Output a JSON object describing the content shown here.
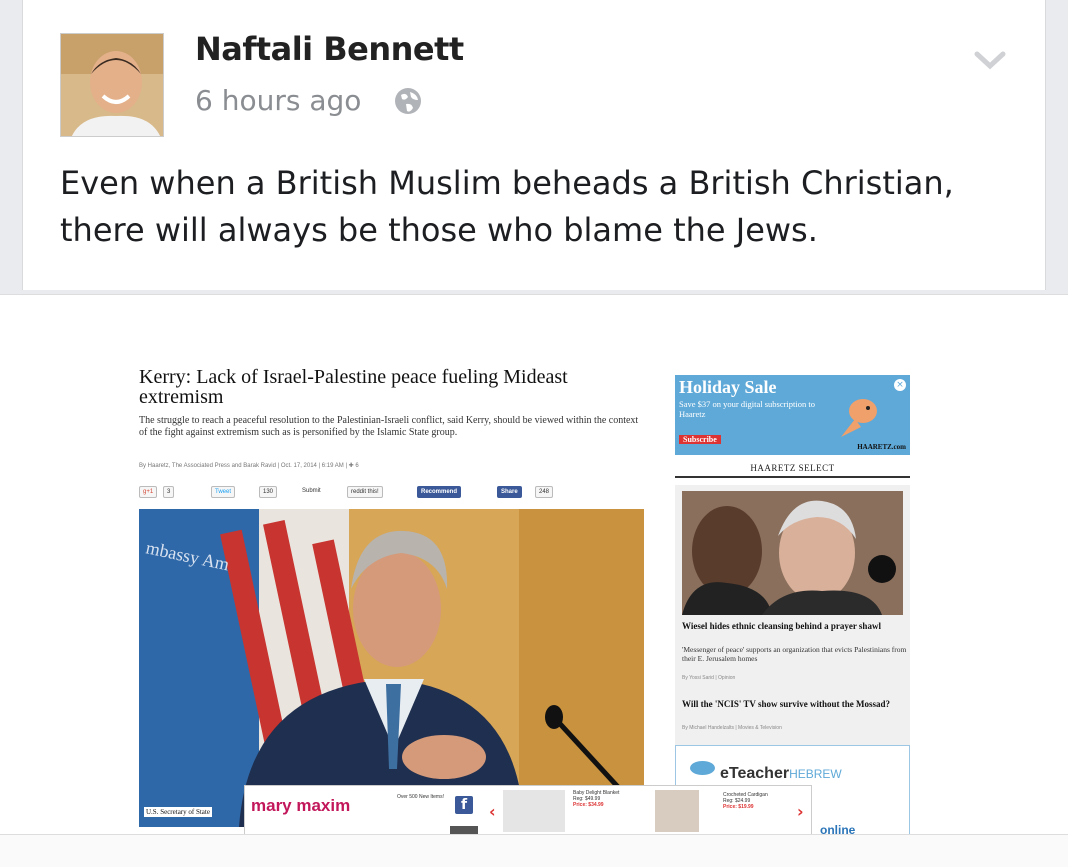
{
  "post": {
    "author": "Naftali Bennett",
    "time": "6 hours ago",
    "text": "Even when a British Muslim beheads a British Christian, there will always be those who blame the Jews.",
    "icons": {
      "privacy": "globe-icon",
      "menu": "chevron-down-icon"
    }
  },
  "article": {
    "headline": "Kerry: Lack of Israel-Palestine peace fueling Mideast extremism",
    "dek": "The struggle to reach a peaceful resolution to the Palestinian-Israeli conflict, said Kerry, should be viewed within the context of the fight against extremism such as is personified by the Islamic State group.",
    "byline": "By Haaretz, The Associated Press and Barak Ravid | Oct. 17, 2014 | 6:19 AM | ✚ 6",
    "share": {
      "gplus": "g+1",
      "gplus_count": "3",
      "tweet": "Tweet",
      "tweet_count": "130",
      "submit": "Submit",
      "reddit": "reddit this!",
      "recommend": "Recommend",
      "share": "Share",
      "share_count": "248"
    },
    "photo_banner": "mbassy Am",
    "caption": "U.S. Secretary of State"
  },
  "sidebar": {
    "ad": {
      "title": "Holiday Sale",
      "text": "Save $37 on your digital subscription to Haaretz",
      "button": "Subscribe",
      "brand": "HAARETZ.com",
      "close": "×"
    },
    "section": "HAARETZ SELECT",
    "story1": {
      "title": "Wiesel hides ethnic cleansing behind a prayer shawl",
      "desc": "'Messenger of peace' supports an organization that evicts Palestinians from their E. Jerusalem homes",
      "byline": "By Yossi Sarid | Opinion"
    },
    "story2": {
      "title": "Will the 'NCIS' TV show survive without the Mossad?",
      "byline": "By Michael Handelzalts | Movies & Television"
    },
    "eteacher": {
      "brand": "eTeacher",
      "suffix": "HEBREW",
      "tagline": "online"
    }
  },
  "adbar": {
    "brand": "mary maxim",
    "promo": "Over 500 New Items!",
    "fb": "f",
    "items": [
      {
        "name": "Baby Delight Blanket",
        "old": "Reg: $49.99",
        "price": "Price: $34.99"
      },
      {
        "name": "Crocheted Cardigan",
        "old": "Reg: $24.99",
        "price": "Price: $19.99"
      }
    ]
  }
}
